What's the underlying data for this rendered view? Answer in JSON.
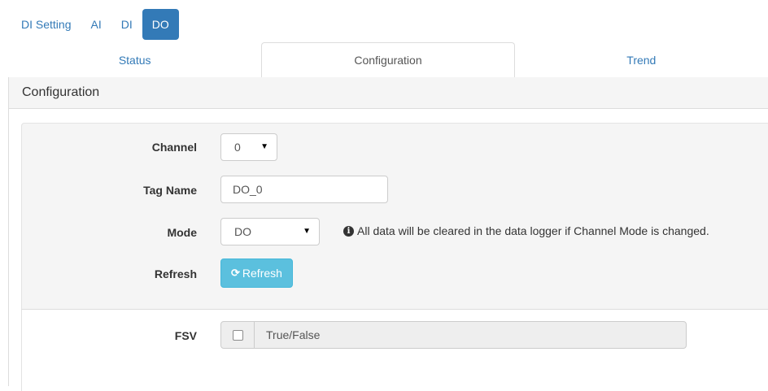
{
  "pills": [
    {
      "label": "DI Setting",
      "active": false
    },
    {
      "label": "AI",
      "active": false
    },
    {
      "label": "DI",
      "active": false
    },
    {
      "label": "DO",
      "active": true
    }
  ],
  "tabs": [
    {
      "label": "Status",
      "active": false
    },
    {
      "label": "Configuration",
      "active": true
    },
    {
      "label": "Trend",
      "active": false
    }
  ],
  "panel": {
    "heading": "Configuration"
  },
  "form": {
    "channel": {
      "label": "Channel",
      "value": "0"
    },
    "tag_name": {
      "label": "Tag Name",
      "value": "DO_0"
    },
    "mode": {
      "label": "Mode",
      "value": "DO",
      "note": "All data will be cleared in the data logger if Channel Mode is changed."
    },
    "refresh": {
      "label": "Refresh",
      "button_label": "Refresh"
    },
    "fsv": {
      "label": "FSV",
      "value": "True/False",
      "checked": false
    }
  },
  "colors": {
    "primary": "#337ab7",
    "info": "#5bc0de",
    "well": "#f5f5f5"
  }
}
